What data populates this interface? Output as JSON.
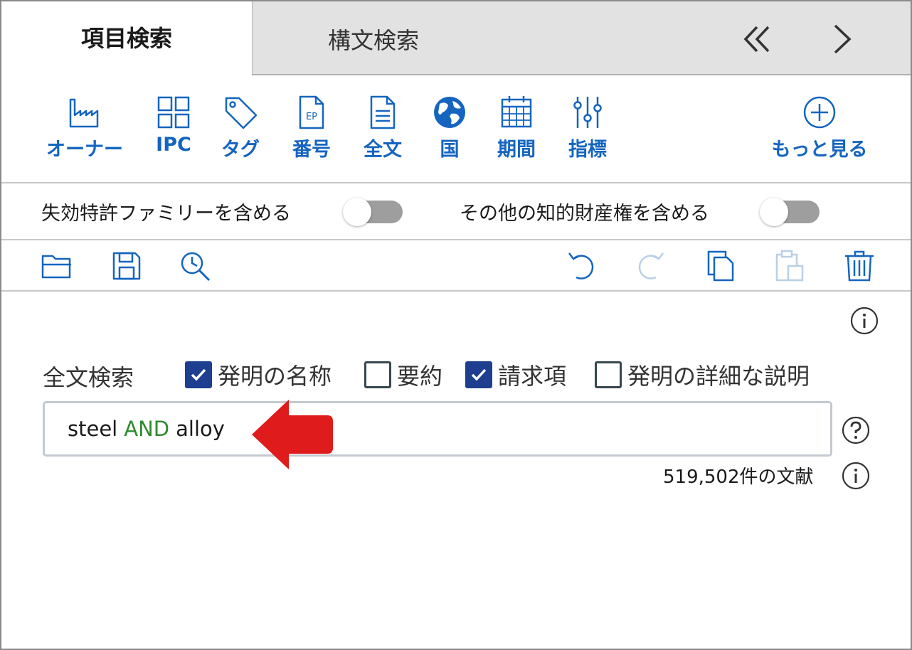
{
  "tabs": {
    "active_label": "項目検索",
    "inactive_label": "構文検索"
  },
  "toolbar": {
    "items": [
      {
        "label": "オーナー",
        "icon": "factory-icon"
      },
      {
        "label": "IPC",
        "icon": "grid-icon"
      },
      {
        "label": "タグ",
        "icon": "tag-icon"
      },
      {
        "label": "番号",
        "icon": "ep-document-icon"
      },
      {
        "label": "全文",
        "icon": "document-text-icon"
      },
      {
        "label": "国",
        "icon": "globe-icon"
      },
      {
        "label": "期間",
        "icon": "calendar-icon"
      },
      {
        "label": "指標",
        "icon": "sliders-icon"
      }
    ],
    "more_label": "もっと見る",
    "accent_color": "#1565c0"
  },
  "toggles": {
    "expired_family_label": "失効特許ファミリーを含める",
    "expired_family_on": false,
    "other_ip_label": "その他の知的財産権を含める",
    "other_ip_on": false
  },
  "search": {
    "section_label": "全文検索",
    "checkboxes": [
      {
        "label": "発明の名称",
        "checked": true
      },
      {
        "label": "要約",
        "checked": false
      },
      {
        "label": "請求項",
        "checked": true
      },
      {
        "label": "発明の詳細な説明",
        "checked": false
      }
    ],
    "query_parts": [
      "steel",
      "AND",
      "alloy"
    ],
    "operator_color": "#2e8b2e",
    "result_count": "519,502件の文献"
  }
}
